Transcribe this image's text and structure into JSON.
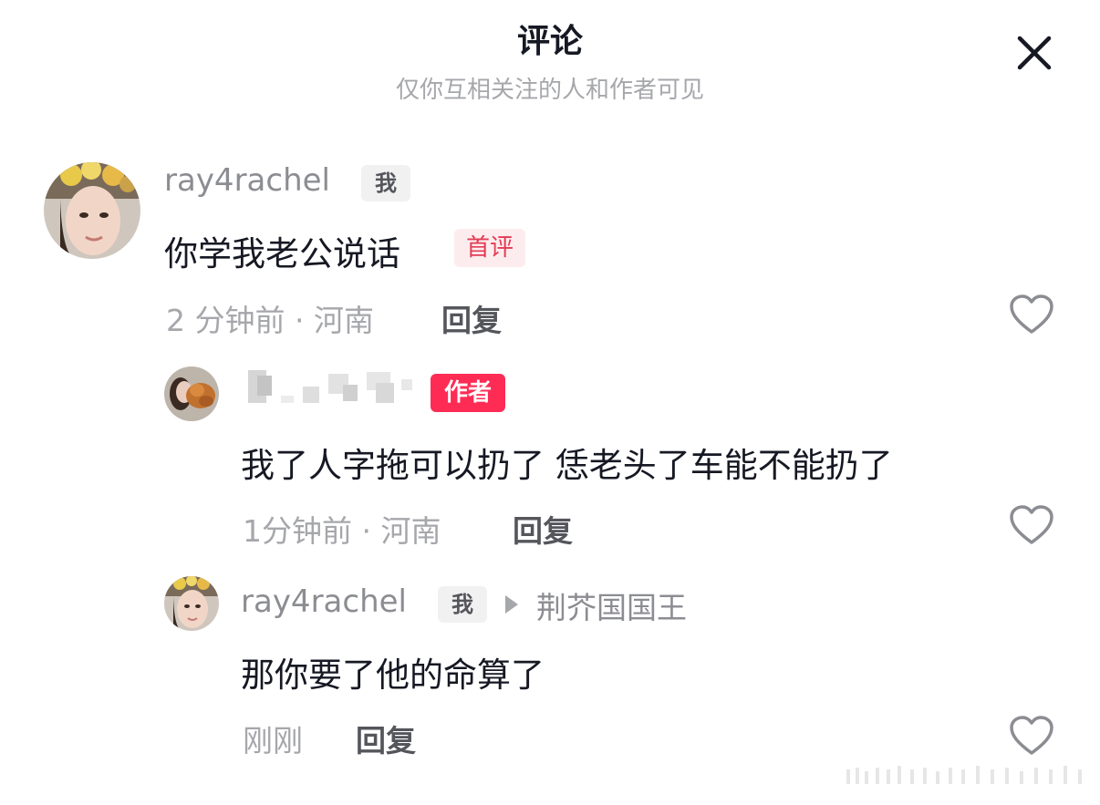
{
  "header": {
    "title": "评论",
    "subtitle": "仅你互相关注的人和作者可见"
  },
  "comments": [
    {
      "username": "ray4rachel",
      "me_tag": "我",
      "text": "你学我老公说话",
      "first_tag": "首评",
      "time_location": "2 分钟前 · 河南",
      "reply_label": "回复"
    },
    {
      "author_tag": "作者",
      "text": "我了人字拖可以扔了 恁老头了车能不能扔了",
      "time_location": "1分钟前 · 河南",
      "reply_label": "回复"
    },
    {
      "username": "ray4rachel",
      "me_tag": "我",
      "reply_to": "荆芥国国王",
      "text": "那你要了他的命算了",
      "time_location": "刚刚",
      "reply_label": "回复"
    }
  ],
  "colors": {
    "author_tag": "#fe2c55",
    "first_tag_text": "#e33b56",
    "muted_text": "#a6a7ab"
  },
  "icons": {
    "close": "close-icon",
    "like": "heart-icon",
    "reply_arrow": "triangle-right-icon"
  }
}
